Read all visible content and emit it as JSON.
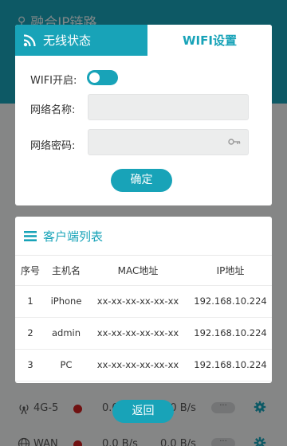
{
  "background": {
    "title": "融合IP链路",
    "links": [
      {
        "name": "4G-5",
        "status_color": "#cc1f1f",
        "rx": "0.0 B/s",
        "tx": "0.0 B/s",
        "more": "···"
      },
      {
        "name": "WAN",
        "status_color": "#cc1f1f",
        "rx": "0.0 B/s",
        "tx": "0.0 B/s",
        "more": "···"
      }
    ]
  },
  "wifi_modal": {
    "tabs": [
      {
        "label": "无线状态",
        "active": true,
        "icon": "wifi-icon"
      },
      {
        "label": "WIFI设置",
        "active": false
      }
    ],
    "enable_label": "WIFI开启:",
    "enabled": true,
    "ssid_label": "网络名称:",
    "ssid_value": "",
    "password_label": "网络密码:",
    "password_value": "",
    "confirm_label": "确定"
  },
  "client_list": {
    "title": "客户端列表",
    "columns": [
      "序号",
      "主机名",
      "MAC地址",
      "IP地址"
    ],
    "rows": [
      [
        "1",
        "iPhone",
        "xx-xx-xx-xx-xx-xx",
        "192.168.10.224"
      ],
      [
        "2",
        "admin",
        "xx-xx-xx-xx-xx-xx",
        "192.168.10.224"
      ],
      [
        "3",
        "PC",
        "xx-xx-xx-xx-xx-xx",
        "192.168.10.224"
      ]
    ]
  },
  "back_label": "返回",
  "colors": {
    "accent": "#18a3b8",
    "offline": "#cc1f1f"
  }
}
